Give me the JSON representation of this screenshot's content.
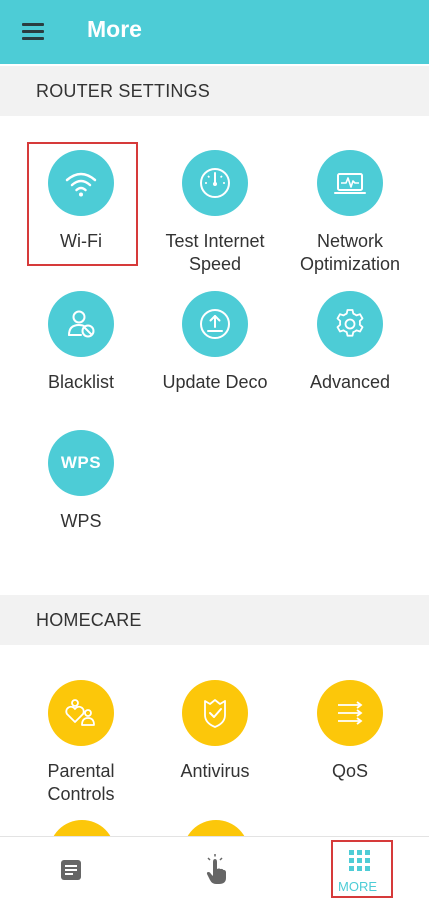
{
  "header": {
    "title": "More",
    "menu_icon": "hamburger-menu-icon"
  },
  "router_settings": {
    "heading": "ROUTER SETTINGS",
    "items": [
      {
        "label": "Wi-Fi",
        "icon": "wifi-icon",
        "highlighted": true
      },
      {
        "label_line1": "Test Internet",
        "label_line2": "Speed",
        "icon": "speedometer-icon"
      },
      {
        "label_line1": "Network",
        "label_line2": "Optimization",
        "icon": "monitor-pulse-icon"
      },
      {
        "label": "Blacklist",
        "icon": "blocked-user-icon"
      },
      {
        "label": "Update Deco",
        "icon": "upload-icon"
      },
      {
        "label": "Advanced",
        "icon": "gear-icon"
      },
      {
        "label": "WPS",
        "icon_text": "WPS"
      }
    ]
  },
  "homecare": {
    "heading": "HOMECARE",
    "items": [
      {
        "label_line1": "Parental",
        "label_line2": "Controls",
        "icon": "parental-controls-icon"
      },
      {
        "label": "Antivirus",
        "icon": "shield-icon"
      },
      {
        "label": "QoS",
        "icon": "qos-arrows-icon"
      }
    ]
  },
  "bottom_nav": {
    "items": [
      {
        "name": "overview",
        "icon": "document-icon"
      },
      {
        "name": "tap",
        "icon": "tap-hand-icon"
      },
      {
        "name": "more",
        "icon": "grid-icon",
        "label": "MORE",
        "active": true,
        "highlighted": true
      }
    ]
  },
  "colors": {
    "teal": "#4dccd6",
    "yellow": "#fcc70a",
    "highlight": "#d63a3a",
    "header_bg": "#4dccd6"
  }
}
